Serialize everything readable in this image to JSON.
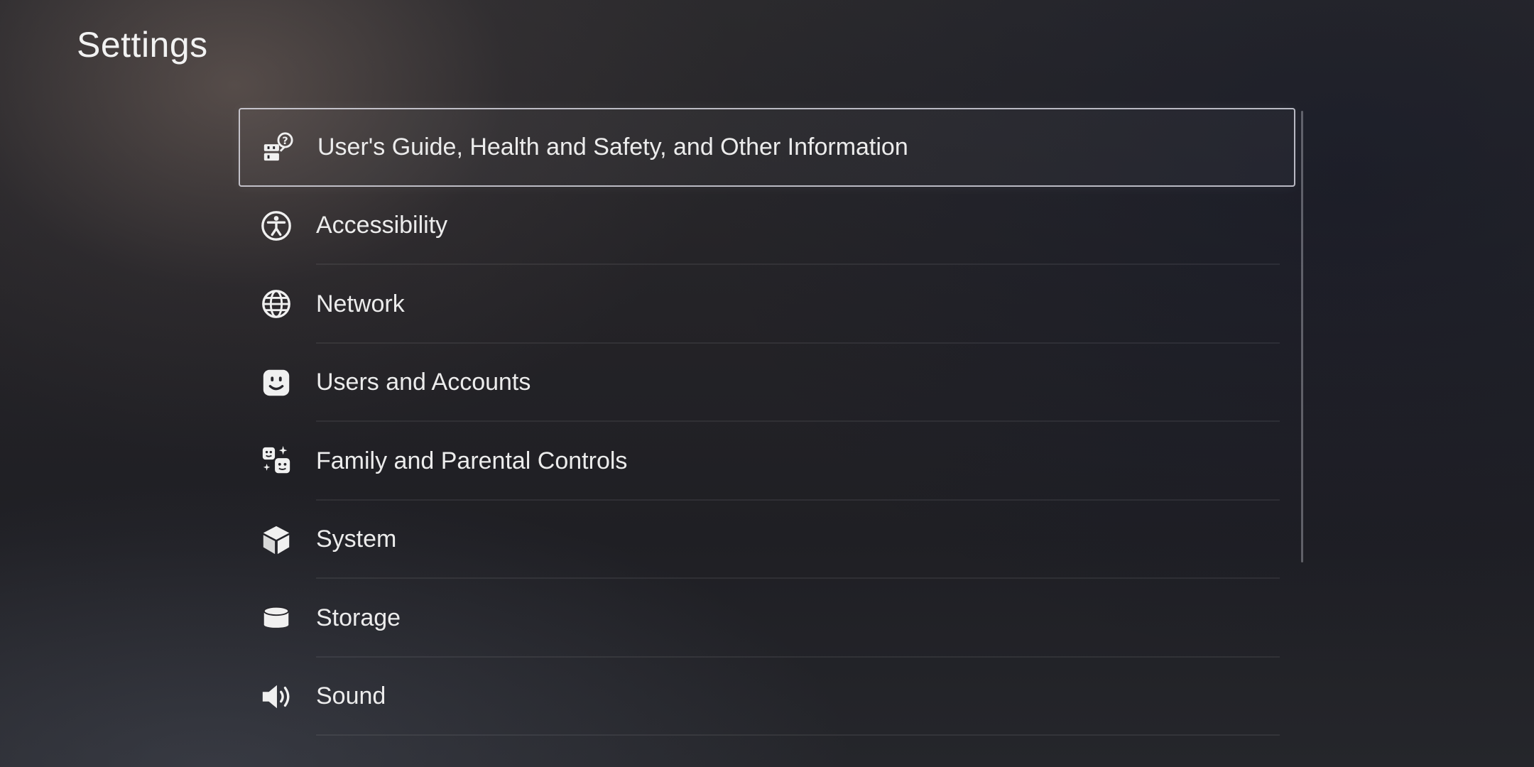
{
  "header": {
    "title": "Settings"
  },
  "menu": {
    "items": [
      {
        "label": "User's Guide, Health and Safety, and Other Information",
        "icon": "users-guide-icon",
        "selected": true
      },
      {
        "label": "Accessibility",
        "icon": "accessibility-icon",
        "selected": false
      },
      {
        "label": "Network",
        "icon": "globe-icon",
        "selected": false
      },
      {
        "label": "Users and Accounts",
        "icon": "user-face-icon",
        "selected": false
      },
      {
        "label": "Family and Parental Controls",
        "icon": "family-icon",
        "selected": false
      },
      {
        "label": "System",
        "icon": "cube-icon",
        "selected": false
      },
      {
        "label": "Storage",
        "icon": "storage-cylinder-icon",
        "selected": false
      },
      {
        "label": "Sound",
        "icon": "speaker-icon",
        "selected": false
      }
    ]
  },
  "colors": {
    "text": "#ececec",
    "focus_border": "#ebebf5",
    "background": "#1f1f24"
  }
}
